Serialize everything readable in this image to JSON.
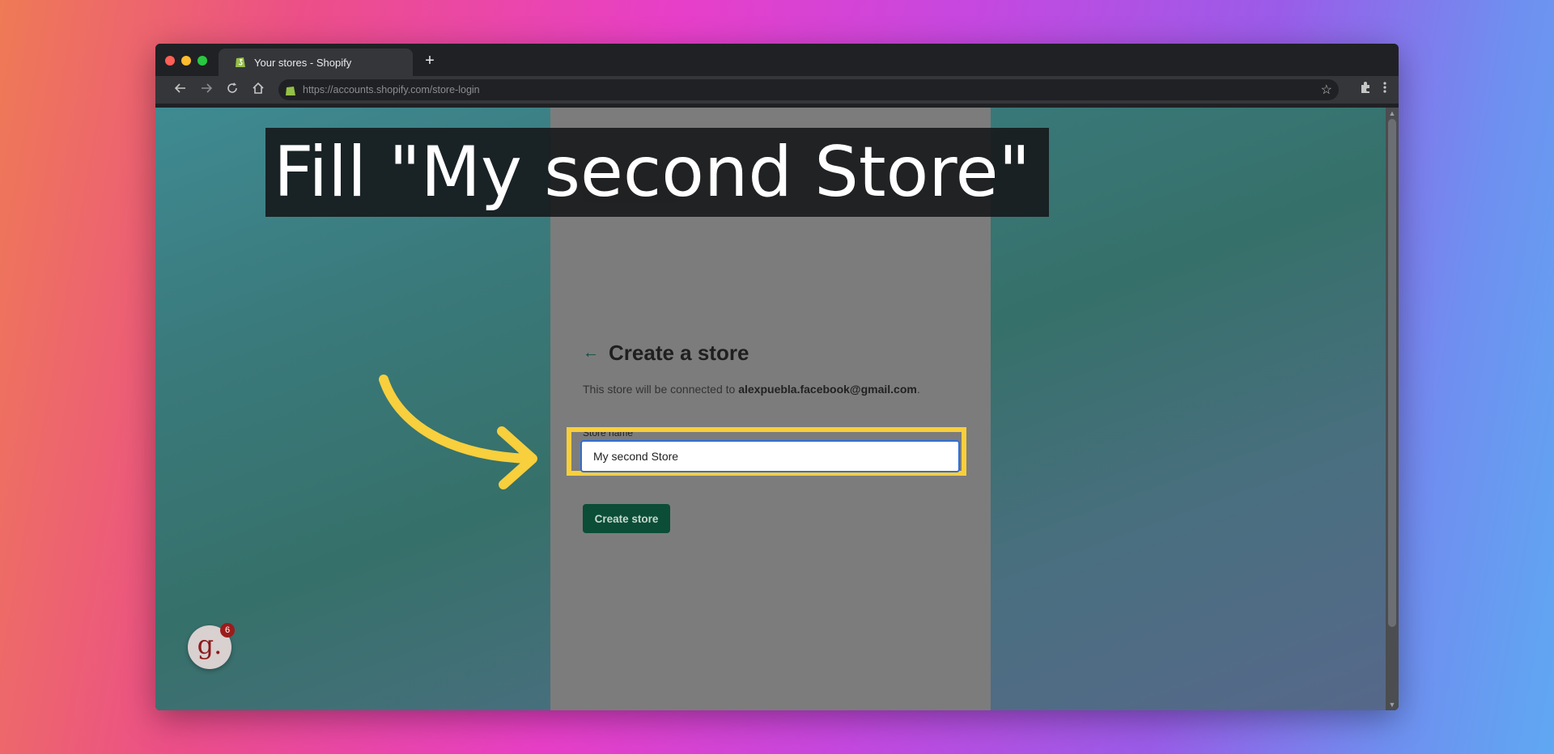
{
  "browser": {
    "tab_title": "Your stores - Shopify",
    "new_tab_symbol": "+",
    "url": "https://accounts.shopify.com/store-login",
    "icons": [
      "back-icon",
      "forward-icon",
      "reload-icon",
      "home-icon",
      "lock-icon",
      "star-icon",
      "extensions-icon",
      "menu-icon"
    ]
  },
  "caption": {
    "text": "Fill \"My second Store\""
  },
  "page": {
    "back_arrow": "←",
    "title": "Create a store",
    "subtitle_prefix": "This store will be connected to ",
    "email": "alexpuebla.facebook@gmail.com",
    "subtitle_suffix": ".",
    "store_name_label": "Store name",
    "store_name_value": "My second Store",
    "create_button": "Create store"
  },
  "overlay": {
    "avatar_letter": "g.",
    "badge_count": "6"
  },
  "colors": {
    "highlight": "#f8cf3c",
    "button": "#0b4d36",
    "input_border": "#2f6fd6"
  }
}
